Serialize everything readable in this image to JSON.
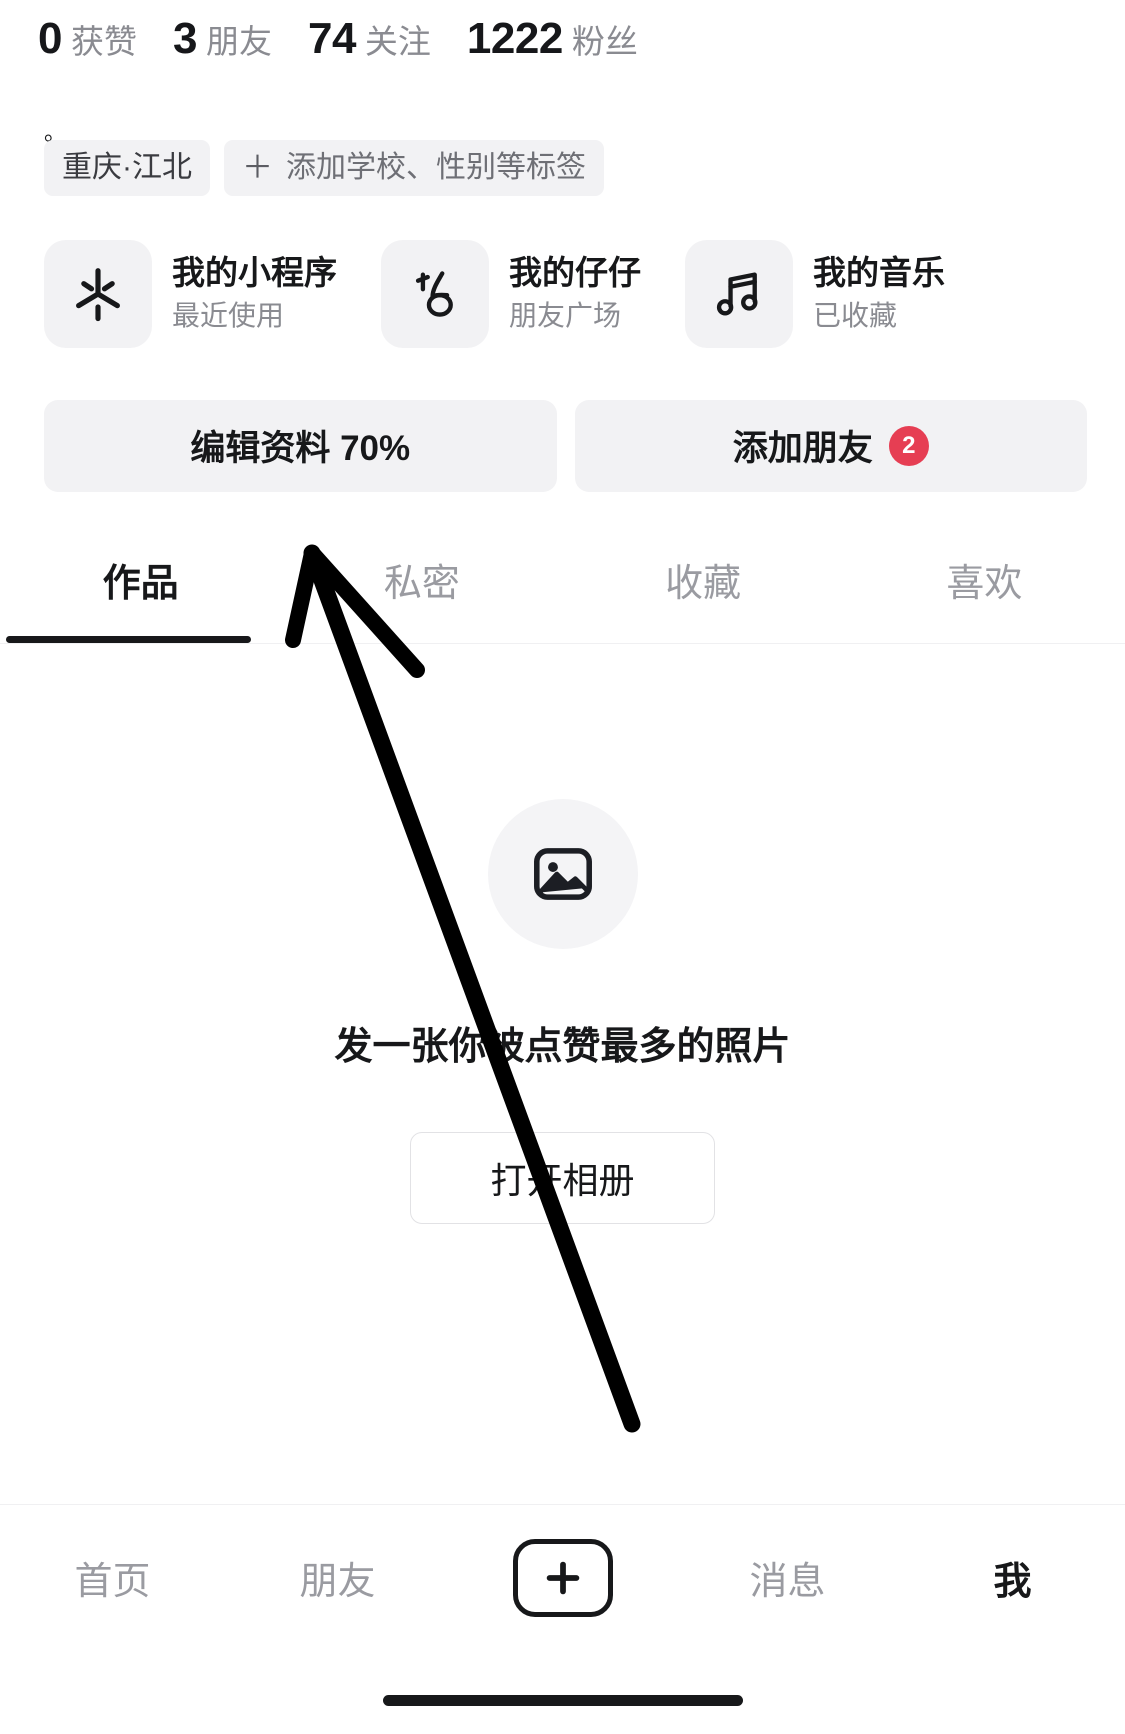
{
  "stats": [
    {
      "num": "0",
      "label": "获赞"
    },
    {
      "num": "3",
      "label": "朋友"
    },
    {
      "num": "74",
      "label": "关注"
    },
    {
      "num": "1222",
      "label": "粉丝"
    }
  ],
  "bio": "。",
  "tags": {
    "location": "重庆·江北",
    "add_plus": "＋",
    "add_label": "添加学校、性别等标签"
  },
  "shortcuts": [
    {
      "icon": "sparkle-icon",
      "title": "我的小程序",
      "sub": "最近使用"
    },
    {
      "icon": "zaizai-icon",
      "title": "我的仔仔",
      "sub": "朋友广场"
    },
    {
      "icon": "music-note-icon",
      "title": "我的音乐",
      "sub": "已收藏"
    }
  ],
  "actions": {
    "edit_profile": "编辑资料 70%",
    "add_friend": "添加朋友",
    "add_friend_badge": "2"
  },
  "tabs": [
    {
      "label": "作品",
      "active": true
    },
    {
      "label": "私密",
      "active": false
    },
    {
      "label": "收藏",
      "active": false
    },
    {
      "label": "喜欢",
      "active": false
    }
  ],
  "empty_state": {
    "icon": "image-placeholder-icon",
    "text": "发一张你被点赞最多的照片",
    "button": "打开相册"
  },
  "bottom_nav": [
    {
      "label": "首页",
      "active": false
    },
    {
      "label": "朋友",
      "active": false
    },
    {
      "label": "+",
      "active": false
    },
    {
      "label": "消息",
      "active": false
    },
    {
      "label": "我",
      "active": true
    }
  ],
  "colors": {
    "text_primary": "#17181A",
    "text_secondary": "#8A8B91",
    "chip_bg": "#F2F2F4",
    "badge_red": "#E63E53",
    "annotation": "#000000"
  }
}
